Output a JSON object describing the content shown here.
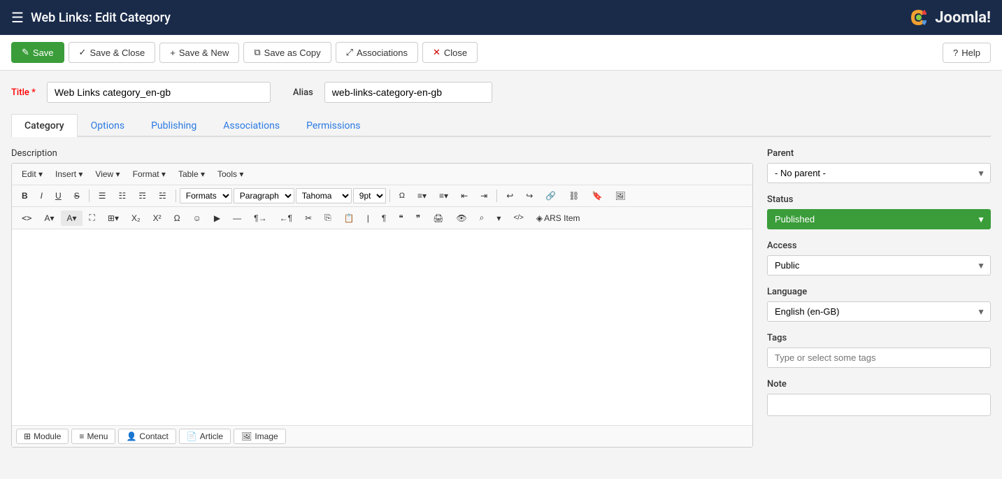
{
  "app": {
    "title": "Web Links: Edit Category",
    "logo": "Joomla!"
  },
  "toolbar": {
    "save_label": "Save",
    "save_close_label": "Save & Close",
    "save_new_label": "Save & New",
    "save_copy_label": "Save as Copy",
    "associations_label": "Associations",
    "close_label": "Close",
    "help_label": "Help"
  },
  "title_field": {
    "label": "Title",
    "required": true,
    "value": "Web Links category_en-gb",
    "placeholder": ""
  },
  "alias_field": {
    "label": "Alias",
    "value": "web-links-category-en-gb",
    "placeholder": ""
  },
  "tabs": [
    {
      "id": "category",
      "label": "Category",
      "active": true
    },
    {
      "id": "options",
      "label": "Options",
      "active": false
    },
    {
      "id": "publishing",
      "label": "Publishing",
      "active": false
    },
    {
      "id": "associations",
      "label": "Associations",
      "active": false
    },
    {
      "id": "permissions",
      "label": "Permissions",
      "active": false
    }
  ],
  "description_label": "Description",
  "editor": {
    "menus": [
      "Edit",
      "Insert",
      "View",
      "Format",
      "Table",
      "Tools"
    ],
    "row1": {
      "bold": "B",
      "italic": "I",
      "underline": "U",
      "strikethrough": "S",
      "align_left": "≡",
      "align_center": "≡",
      "align_right": "≡",
      "align_justify": "≡",
      "formats_label": "Formats",
      "paragraph_label": "Paragraph",
      "font_label": "Tahoma",
      "size_label": "9pt"
    },
    "bottom_buttons": [
      "Module",
      "Menu",
      "Contact",
      "Article",
      "Image"
    ]
  },
  "sidebar": {
    "parent_label": "Parent",
    "parent_value": "- No parent -",
    "status_label": "Status",
    "status_value": "Published",
    "access_label": "Access",
    "access_value": "Public",
    "language_label": "Language",
    "language_value": "English (en-GB)",
    "tags_label": "Tags",
    "tags_placeholder": "Type or select some tags",
    "note_label": "Note"
  }
}
